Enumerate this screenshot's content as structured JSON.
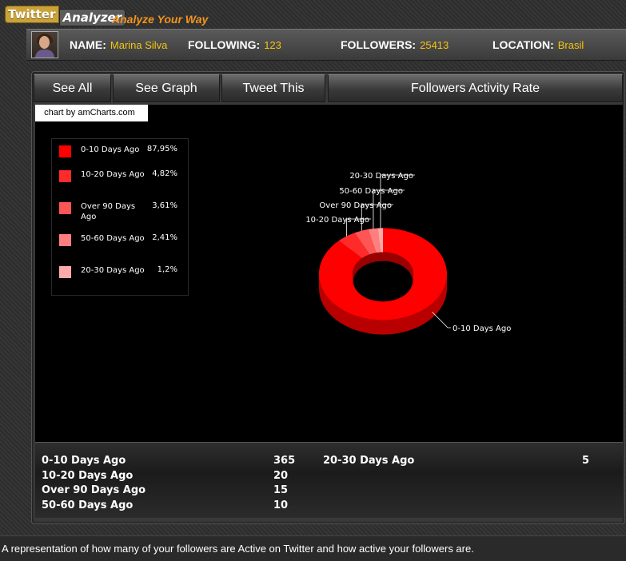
{
  "app": {
    "logo_part1": "Twitter",
    "logo_part2": "Analyzer",
    "tagline": "Analyze Your Way"
  },
  "profile": {
    "name_label": "NAME:",
    "name": "Marina Silva",
    "following_label": "FOLLOWING:",
    "following": "123",
    "followers_label": "FOLLOWERS:",
    "followers": "25413",
    "location_label": "LOCATION:",
    "location": "Brasil"
  },
  "tabs": [
    {
      "label": "See All"
    },
    {
      "label": "See Graph"
    },
    {
      "label": "Tweet This"
    },
    {
      "label": "Followers Activity Rate"
    }
  ],
  "chart_credit": "chart by amCharts.com",
  "legend": [
    {
      "label": "0-10 Days Ago",
      "value": "87,95%",
      "color": "#ff0000"
    },
    {
      "label": "10-20 Days Ago",
      "value": "4,82%",
      "color": "#ff2a2a"
    },
    {
      "label": "Over 90 Days Ago",
      "value": "3,61%",
      "color": "#ff5555"
    },
    {
      "label": "50-60 Days Ago",
      "value": "2,41%",
      "color": "#ff7f7f"
    },
    {
      "label": "20-30 Days Ago",
      "value": "1,2%",
      "color": "#ffaaaa"
    }
  ],
  "chart_data": {
    "type": "pie",
    "style": "3d-donut",
    "categories": [
      "0-10 Days Ago",
      "10-20 Days Ago",
      "Over 90 Days Ago",
      "50-60 Days Ago",
      "20-30 Days Ago"
    ],
    "values": [
      365,
      20,
      15,
      10,
      5
    ],
    "percent_labels": [
      "87,95%",
      "4,82%",
      "3,61%",
      "2,41%",
      "1,2%"
    ],
    "colors": [
      "#ff0000",
      "#ff2a2a",
      "#ff5555",
      "#ff7f7f",
      "#ffaaaa"
    ],
    "legend_position": "top-left"
  },
  "stats": {
    "rows": [
      {
        "label": "0-10 Days Ago",
        "value": "365"
      },
      {
        "label": "10-20 Days Ago",
        "value": "20"
      },
      {
        "label": "Over 90 Days Ago",
        "value": "15"
      },
      {
        "label": "50-60 Days Ago",
        "value": "10"
      },
      {
        "label": "20-30 Days Ago",
        "value": "5"
      }
    ]
  },
  "footer": {
    "text": "A representation of how many of your followers are Active on Twitter and how active your followers are."
  }
}
